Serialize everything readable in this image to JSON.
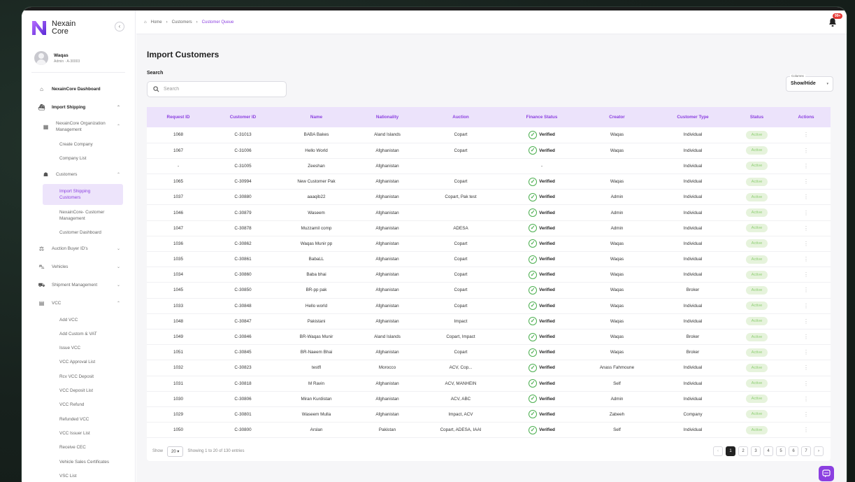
{
  "app": {
    "name_line1": "Nexain",
    "name_line2": "Core"
  },
  "user": {
    "name": "Waqas",
    "role": "Admin · A-30003"
  },
  "sidebar": {
    "items": [
      {
        "label": "NexainCore Dashboard"
      },
      {
        "label": "Import Shipping"
      },
      {
        "label": "NexainCore Organization Management"
      },
      {
        "label": "Create Company"
      },
      {
        "label": "Company List"
      },
      {
        "label": "Customers"
      },
      {
        "label": "Import Shipping Customers"
      },
      {
        "label": "NexainCore- Customer Management"
      },
      {
        "label": "Customer Dashboard"
      },
      {
        "label": "Auction Buyer ID's"
      },
      {
        "label": "Vehicles"
      },
      {
        "label": "Shipment Management"
      },
      {
        "label": "VCC"
      },
      {
        "label": "Add VCC"
      },
      {
        "label": "Add Custom & VAT"
      },
      {
        "label": "Issue VCC"
      },
      {
        "label": "VCC Approval List"
      },
      {
        "label": "Rcv VCC Deposit"
      },
      {
        "label": "VCC Deposit List"
      },
      {
        "label": "VCC Refund"
      },
      {
        "label": "Refunded VCC"
      },
      {
        "label": "VCC Issuer List"
      },
      {
        "label": "Receive CEC"
      },
      {
        "label": "Vehicle Sales Certificates"
      },
      {
        "label": "VSC List"
      }
    ]
  },
  "breadcrumb": {
    "home": "Home",
    "customers": "Customers",
    "current": "Customer Queue"
  },
  "notifications": {
    "count": "99+"
  },
  "page": {
    "title": "Import Customers"
  },
  "search": {
    "label": "Search",
    "placeholder": "Search",
    "value": ""
  },
  "columns": {
    "label": "Columns",
    "value": "Show/Hide"
  },
  "table": {
    "headers": [
      "Request ID",
      "Customer ID",
      "Name",
      "Nationality",
      "Auction",
      "Finance Status",
      "Creator",
      "Customer Type",
      "Status",
      "Actions"
    ],
    "rows": [
      [
        "1068",
        "C-31013",
        "BABA Bakes",
        "Aland Islands",
        "Copart",
        "Verified",
        "Waqas",
        "Individual",
        "Active"
      ],
      [
        "1067",
        "C-31006",
        "Hello World",
        "Afghanistan",
        "Copart",
        "Verified",
        "Waqas",
        "Individual",
        "Active"
      ],
      [
        "-",
        "C-31005",
        "Zeeshan",
        "Afghanistan",
        "",
        "-",
        "",
        "Individual",
        "Active"
      ],
      [
        "1065",
        "C-30994",
        "New Customer Pak",
        "Afghanistan",
        "Copart",
        "Verified",
        "Waqas",
        "Individual",
        "Active"
      ],
      [
        "1037",
        "C-30880",
        "aaaqib22",
        "Afghanistan",
        "Copart, Pak test",
        "Verified",
        "Admin",
        "Individual",
        "Active"
      ],
      [
        "1046",
        "C-30879",
        "Waseem",
        "Afghanistan",
        "",
        "Verified",
        "Admin",
        "Individual",
        "Active"
      ],
      [
        "1047",
        "C-30878",
        "Muzzamil comp",
        "Afghanistan",
        "ADESA",
        "Verified",
        "Admin",
        "Individual",
        "Active"
      ],
      [
        "1036",
        "C-30862",
        "Waqas Munir pp",
        "Afghanistan",
        "Copart",
        "Verified",
        "Waqas",
        "Individual",
        "Active"
      ],
      [
        "1035",
        "C-30861",
        "BabaLL",
        "Afghanistan",
        "Copart",
        "Verified",
        "Waqas",
        "Individual",
        "Active"
      ],
      [
        "1034",
        "C-30860",
        "Baba bhai",
        "Afghanistan",
        "Copart",
        "Verified",
        "Waqas",
        "Individual",
        "Active"
      ],
      [
        "1045",
        "C-30850",
        "BR-pp pak",
        "Afghanistan",
        "Copart",
        "Verified",
        "Waqas",
        "Broker",
        "Active"
      ],
      [
        "1033",
        "C-30848",
        "Hello world",
        "Afghanistan",
        "Copart",
        "Verified",
        "Waqas",
        "Individual",
        "Active"
      ],
      [
        "1048",
        "C-30847",
        "Pakistani",
        "Afghanistan",
        "Impact",
        "Verified",
        "Waqas",
        "Individual",
        "Active"
      ],
      [
        "1049",
        "C-30846",
        "BR-Waqas Munir",
        "Aland Islands",
        "Copart, Impact",
        "Verified",
        "Waqas",
        "Broker",
        "Active"
      ],
      [
        "1051",
        "C-30845",
        "BR-Naeem Bhai",
        "Afghanistan",
        "Copart",
        "Verified",
        "Waqas",
        "Broker",
        "Active"
      ],
      [
        "1032",
        "C-30823",
        "testfl",
        "Morocco",
        "ACV, Cop...",
        "Verified",
        "Anass Fahmoune",
        "Individual",
        "Active"
      ],
      [
        "1031",
        "C-30818",
        "M Ravin",
        "Afghanistan",
        "ACV, MANHEIN",
        "Verified",
        "Self",
        "Individual",
        "Active"
      ],
      [
        "1030",
        "C-30806",
        "Miran Kurdistan",
        "Afghanistan",
        "ACV, ABC",
        "Verified",
        "Admin",
        "Individual",
        "Active"
      ],
      [
        "1029",
        "C-30801",
        "Waseem Mulla",
        "Afghanistan",
        "Impact, ACV",
        "Verified",
        "Zabeeh",
        "Company",
        "Active"
      ],
      [
        "1050",
        "C-30800",
        "Arslan",
        "Pakistan",
        "Copart, ADESA, IAAI",
        "Verified",
        "Self",
        "Individual",
        "Active"
      ]
    ]
  },
  "footer": {
    "show_label": "Show",
    "page_size": "20",
    "summary": "Showing 1 to 20 of 130 entries"
  },
  "pagination": {
    "prev": "‹",
    "pages": [
      "1",
      "2",
      "3",
      "4",
      "5",
      "6",
      "7"
    ],
    "next": "›",
    "current": "1"
  },
  "colors": {
    "accent": "#8b3fe0",
    "header_bg": "#ece3fb",
    "verified": "#4caf50",
    "active_bg": "#e6f3dc"
  }
}
